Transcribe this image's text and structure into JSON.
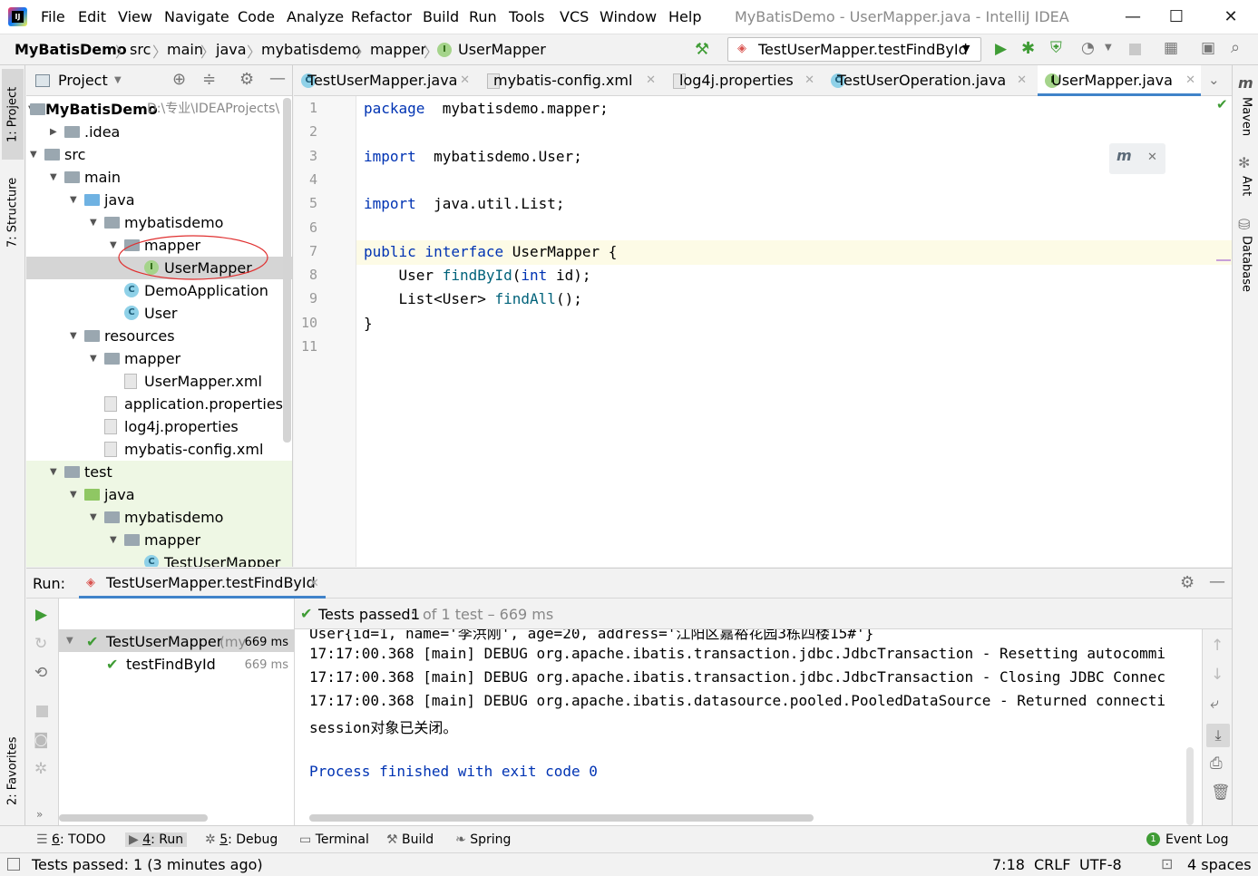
{
  "window": {
    "title": "MyBatisDemo - UserMapper.java - IntelliJ IDEA",
    "menu": [
      "File",
      "Edit",
      "View",
      "Navigate",
      "Code",
      "Analyze",
      "Refactor",
      "Build",
      "Run",
      "Tools",
      "VCS",
      "Window",
      "Help"
    ]
  },
  "breadcrumb": [
    "MyBatisDemo",
    "src",
    "main",
    "java",
    "mybatisdemo",
    "mapper",
    "UserMapper"
  ],
  "run_config": "TestUserMapper.testFindById",
  "left_tools": {
    "project": "1: Project",
    "structure": "7: Structure",
    "favorites": "2: Favorites"
  },
  "right_tools": {
    "maven": "Maven",
    "ant": "Ant",
    "database": "Database"
  },
  "project": {
    "header": "Project",
    "root_name": "MyBatisDemo",
    "root_path": "D:\\专业\\IDEAProjects\\",
    "tree": [
      {
        "label": ".idea",
        "indent": 1,
        "arrow": "▶",
        "icon": "folder"
      },
      {
        "label": "src",
        "indent": 0,
        "arrow": "▼",
        "icon": "folder"
      },
      {
        "label": "main",
        "indent": 1,
        "arrow": "▼",
        "icon": "folder"
      },
      {
        "label": "java",
        "indent": 2,
        "arrow": "▼",
        "icon": "folder-blue"
      },
      {
        "label": "mybatisdemo",
        "indent": 3,
        "arrow": "▼",
        "icon": "folder"
      },
      {
        "label": "mapper",
        "indent": 4,
        "arrow": "▼",
        "icon": "folder"
      },
      {
        "label": "UserMapper",
        "indent": 5,
        "arrow": "",
        "icon": "interface",
        "selected": true
      },
      {
        "label": "DemoApplication",
        "indent": 4,
        "arrow": "",
        "icon": "class"
      },
      {
        "label": "User",
        "indent": 4,
        "arrow": "",
        "icon": "class"
      },
      {
        "label": "resources",
        "indent": 2,
        "arrow": "▼",
        "icon": "folder"
      },
      {
        "label": "mapper",
        "indent": 3,
        "arrow": "▼",
        "icon": "folder"
      },
      {
        "label": "UserMapper.xml",
        "indent": 4,
        "arrow": "",
        "icon": "file"
      },
      {
        "label": "application.properties",
        "indent": 3,
        "arrow": "",
        "icon": "file"
      },
      {
        "label": "log4j.properties",
        "indent": 3,
        "arrow": "",
        "icon": "file"
      },
      {
        "label": "mybatis-config.xml",
        "indent": 3,
        "arrow": "",
        "icon": "file"
      },
      {
        "label": "test",
        "indent": 1,
        "arrow": "▼",
        "icon": "folder"
      },
      {
        "label": "java",
        "indent": 2,
        "arrow": "▼",
        "icon": "folder-green"
      },
      {
        "label": "mybatisdemo",
        "indent": 3,
        "arrow": "▼",
        "icon": "folder"
      },
      {
        "label": "mapper",
        "indent": 4,
        "arrow": "▼",
        "icon": "folder"
      },
      {
        "label": "TestUserMapper",
        "indent": 5,
        "arrow": "",
        "icon": "class"
      }
    ]
  },
  "editor_tabs": [
    {
      "label": "TestUserMapper.java",
      "icon": "class"
    },
    {
      "label": "mybatis-config.xml",
      "icon": "file"
    },
    {
      "label": "log4j.properties",
      "icon": "file"
    },
    {
      "label": "TestUserOperation.java",
      "icon": "class"
    },
    {
      "label": "UserMapper.java",
      "icon": "interface",
      "active": true
    }
  ],
  "code_lines": [
    {
      "n": "1",
      "parts": [
        [
          "kw",
          "package"
        ],
        [
          "",
          "  mybatisdemo.mapper;"
        ]
      ]
    },
    {
      "n": "2",
      "parts": []
    },
    {
      "n": "3",
      "parts": [
        [
          "kw",
          "import"
        ],
        [
          "",
          "  mybatisdemo.User;"
        ]
      ]
    },
    {
      "n": "4",
      "parts": []
    },
    {
      "n": "5",
      "parts": [
        [
          "kw",
          "import"
        ],
        [
          "",
          "  java.util.List;"
        ]
      ]
    },
    {
      "n": "6",
      "parts": []
    },
    {
      "n": "7",
      "parts": [
        [
          "kw",
          "public interface"
        ],
        [
          "",
          " UserMapper {"
        ]
      ]
    },
    {
      "n": "8",
      "parts": [
        [
          "",
          "    User "
        ],
        [
          "fn",
          "findById"
        ],
        [
          "",
          "("
        ],
        [
          "kw",
          "int"
        ],
        [
          "",
          " id);"
        ]
      ]
    },
    {
      "n": "9",
      "parts": [
        [
          "",
          "    List<User> "
        ],
        [
          "fn",
          "findAll"
        ],
        [
          "",
          "();"
        ]
      ]
    },
    {
      "n": "10",
      "parts": [
        [
          "",
          "}"
        ]
      ]
    },
    {
      "n": "11",
      "parts": []
    }
  ],
  "run_panel": {
    "label": "Run:",
    "tab": "TestUserMapper.testFindById",
    "status_passed": "Tests passed:",
    "status_count": "1",
    "status_rest": "of 1 test – 669 ms",
    "tests": [
      {
        "label": "TestUserMapper",
        "suffix": "(my",
        "time": "669 ms",
        "indent": 0
      },
      {
        "label": "testFindById",
        "suffix": "",
        "time": "669 ms",
        "indent": 1
      }
    ],
    "console": [
      "User{id=1, name='李洪刚', age=20, address='江阳区嘉裕花园3栋四楼15#'}",
      "17:17:00.368 [main] DEBUG org.apache.ibatis.transaction.jdbc.JdbcTransaction - Resetting autocommi",
      "17:17:00.368 [main] DEBUG org.apache.ibatis.transaction.jdbc.JdbcTransaction - Closing JDBC Connec",
      "17:17:00.368 [main] DEBUG org.apache.ibatis.datasource.pooled.PooledDataSource - Returned connecti",
      "session对象已关闭。",
      "",
      "Process finished with exit code 0"
    ]
  },
  "bottom_tabs": [
    {
      "key": "6",
      "label": ": TODO"
    },
    {
      "key": "4",
      "label": ": Run"
    },
    {
      "key": "5",
      "label": ": Debug"
    },
    {
      "key": "",
      "label": "Terminal"
    },
    {
      "key": "",
      "label": "Build"
    },
    {
      "key": "",
      "label": "Spring"
    }
  ],
  "event_log": "Event Log",
  "status": {
    "message": "Tests passed: 1 (3 minutes ago)",
    "position": "7:18",
    "line_sep": "CRLF",
    "encoding": "UTF-8",
    "indent": "4 spaces"
  }
}
